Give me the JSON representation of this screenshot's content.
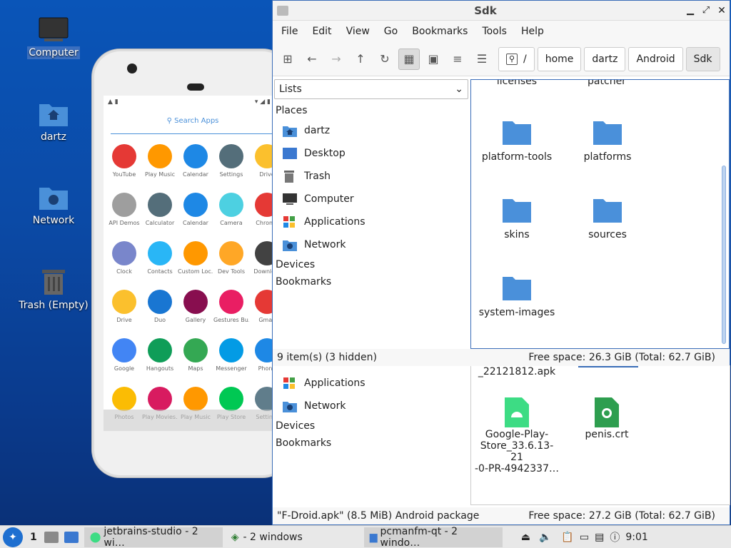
{
  "desktop": {
    "icons": [
      {
        "label": "Computer"
      },
      {
        "label": "dartz"
      },
      {
        "label": "Network"
      },
      {
        "label": "Trash (Empty)"
      }
    ]
  },
  "phone": {
    "search_label": "Search Apps",
    "apps": [
      "YouTube",
      "Play Music",
      "Calendar",
      "Settings",
      "Drive",
      "API Demos",
      "Calculator",
      "Calendar",
      "Camera",
      "Chrome",
      "Clock",
      "Contacts",
      "Custom Loc...",
      "Dev Tools",
      "Downlo...",
      "Drive",
      "Duo",
      "Gallery",
      "Gestures Bu...",
      "Gmail",
      "Google",
      "Hangouts",
      "Maps",
      "Messenger",
      "Phone",
      "Photos",
      "Play Movies...",
      "Play Music",
      "Play Store",
      "Settin..."
    ],
    "app_colors": [
      "#e53935",
      "#ff9800",
      "#1e88e5",
      "#546e7a",
      "#fbc02d",
      "#9e9e9e",
      "#546e7a",
      "#1e88e5",
      "#4dd0e1",
      "#e53935",
      "#7986cb",
      "#29b6f6",
      "#ff9800",
      "#ffa726",
      "#424242",
      "#fbc02d",
      "#1976d2",
      "#880e4f",
      "#e91e63",
      "#e53935",
      "#4285f4",
      "#0f9d58",
      "#34a853",
      "#039be5",
      "#1e88e5",
      "#fbbc04",
      "#d81b60",
      "#ff9800",
      "#00c853",
      "#607d8b"
    ]
  },
  "back_window": {
    "places": [
      {
        "label": "Applications"
      },
      {
        "label": "Network"
      }
    ],
    "sections": [
      "Devices",
      "Bookmarks"
    ],
    "files": [
      {
        "name": "_22121812.apk"
      },
      {
        "name": "Google-Play-\nStore_33.6.13-21\n-0-PR-4942337…"
      },
      {
        "name": "penis.crt"
      }
    ],
    "status_left": "\"F-Droid.apk\" (8.5 MiB) Android package",
    "status_right": "Free space: 27.2 GiB (Total: 62.7 GiB)"
  },
  "sdk_window": {
    "title": "Sdk",
    "menu": [
      "File",
      "Edit",
      "View",
      "Go",
      "Bookmarks",
      "Tools",
      "Help"
    ],
    "breadcrumbs": [
      "/",
      "home",
      "dartz",
      "Android",
      "Sdk"
    ],
    "sidepane_select": "Lists",
    "places_header": "Places",
    "places": [
      {
        "label": "dartz",
        "icon": "home-folder-icon"
      },
      {
        "label": "Desktop",
        "icon": "desktop-icon"
      },
      {
        "label": "Trash",
        "icon": "trash-icon"
      },
      {
        "label": "Computer",
        "icon": "computer-icon"
      },
      {
        "label": "Applications",
        "icon": "applications-icon"
      },
      {
        "label": "Network",
        "icon": "network-icon"
      }
    ],
    "sections": [
      "Devices",
      "Bookmarks"
    ],
    "top_partial": [
      "licenses",
      "patcher"
    ],
    "folders": [
      "platform-tools",
      "platforms",
      "skins",
      "sources",
      "system-images"
    ],
    "status_left": "9 item(s) (3 hidden)",
    "status_right": "Free space: 26.3 GiB (Total: 62.7 GiB)",
    "accent": "#3a6db8",
    "folder_color": "#4a90d9"
  },
  "taskbar": {
    "workspace": "1",
    "tasks": [
      "jetbrains-studio - 2 wi…",
      "- 2 windows",
      "pcmanfm-qt - 2 windo…"
    ],
    "clock": "9:01"
  }
}
